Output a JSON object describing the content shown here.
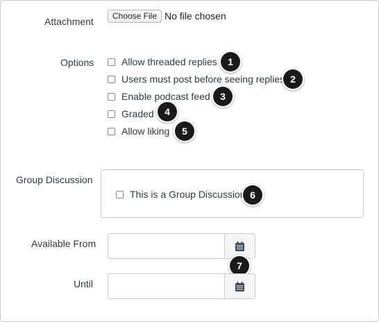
{
  "attachment": {
    "label": "Attachment",
    "choose_file_label": "Choose File",
    "file_status": "No file chosen"
  },
  "options": {
    "label": "Options",
    "items": [
      {
        "label": "Allow threaded replies",
        "checked": false,
        "badge": "1"
      },
      {
        "label": "Users must post before seeing replies",
        "checked": false,
        "badge": "2"
      },
      {
        "label": "Enable podcast feed",
        "checked": false,
        "badge": "3"
      },
      {
        "label": "Graded",
        "checked": false,
        "badge": "4"
      },
      {
        "label": "Allow liking",
        "checked": false,
        "badge": "5"
      }
    ]
  },
  "group_discussion": {
    "label": "Group Discussion",
    "checkbox_label": "This is a Group Discussion",
    "checked": false,
    "badge": "6"
  },
  "dates": {
    "available_from_label": "Available From",
    "available_from_value": "",
    "until_label": "Until",
    "until_value": "",
    "badge": "7"
  },
  "colors": {
    "text": "#2d3b45",
    "badge_bg": "#1a1a1a",
    "calendar_icon": "#3b4a58",
    "border": "#c7cdd1"
  },
  "icons": {
    "calendar": "calendar-icon"
  }
}
